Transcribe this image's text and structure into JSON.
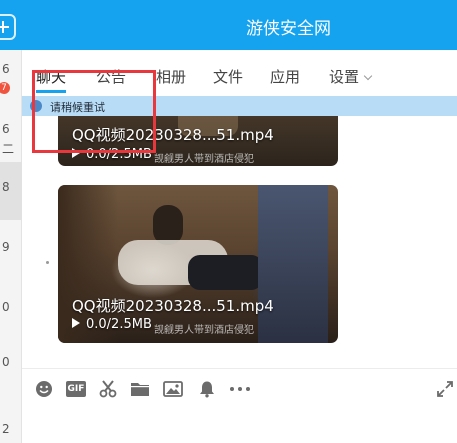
{
  "header": {
    "title": "游侠安全网"
  },
  "left_list": {
    "numbers": [
      "6",
      "6",
      "8",
      "9",
      "0",
      "0",
      "2"
    ],
    "badge": "7",
    "fragment": "二"
  },
  "tabs": [
    {
      "label": "聊天",
      "active": true
    },
    {
      "label": "公告",
      "active": false
    },
    {
      "label": "相册",
      "active": false
    },
    {
      "label": "文件",
      "active": false
    },
    {
      "label": "应用",
      "active": false
    },
    {
      "label": "设置",
      "active": false
    }
  ],
  "notice": {
    "text": "请稍候重试"
  },
  "messages": [
    {
      "type": "video",
      "filename": "QQ视频20230328...51.mp4",
      "progress": "0.0/2.5MB",
      "subtitle": "觊觎男人带到酒店侵犯"
    },
    {
      "type": "video",
      "filename": "QQ视频20230328...51.mp4",
      "progress": "0.0/2.5MB",
      "subtitle": "觊觎男人带到酒店侵犯"
    }
  ],
  "toolbar": {
    "gif_label": "GIF",
    "icons": [
      "emoji-icon",
      "gif-icon",
      "scissors-icon",
      "folder-icon",
      "image-icon",
      "bell-icon",
      "more-icon",
      "expand-icon"
    ]
  },
  "colors": {
    "header": "#15a3f0",
    "notice_bg": "#b9dcf6",
    "highlight": "#e8383d",
    "badge": "#f0533e"
  }
}
